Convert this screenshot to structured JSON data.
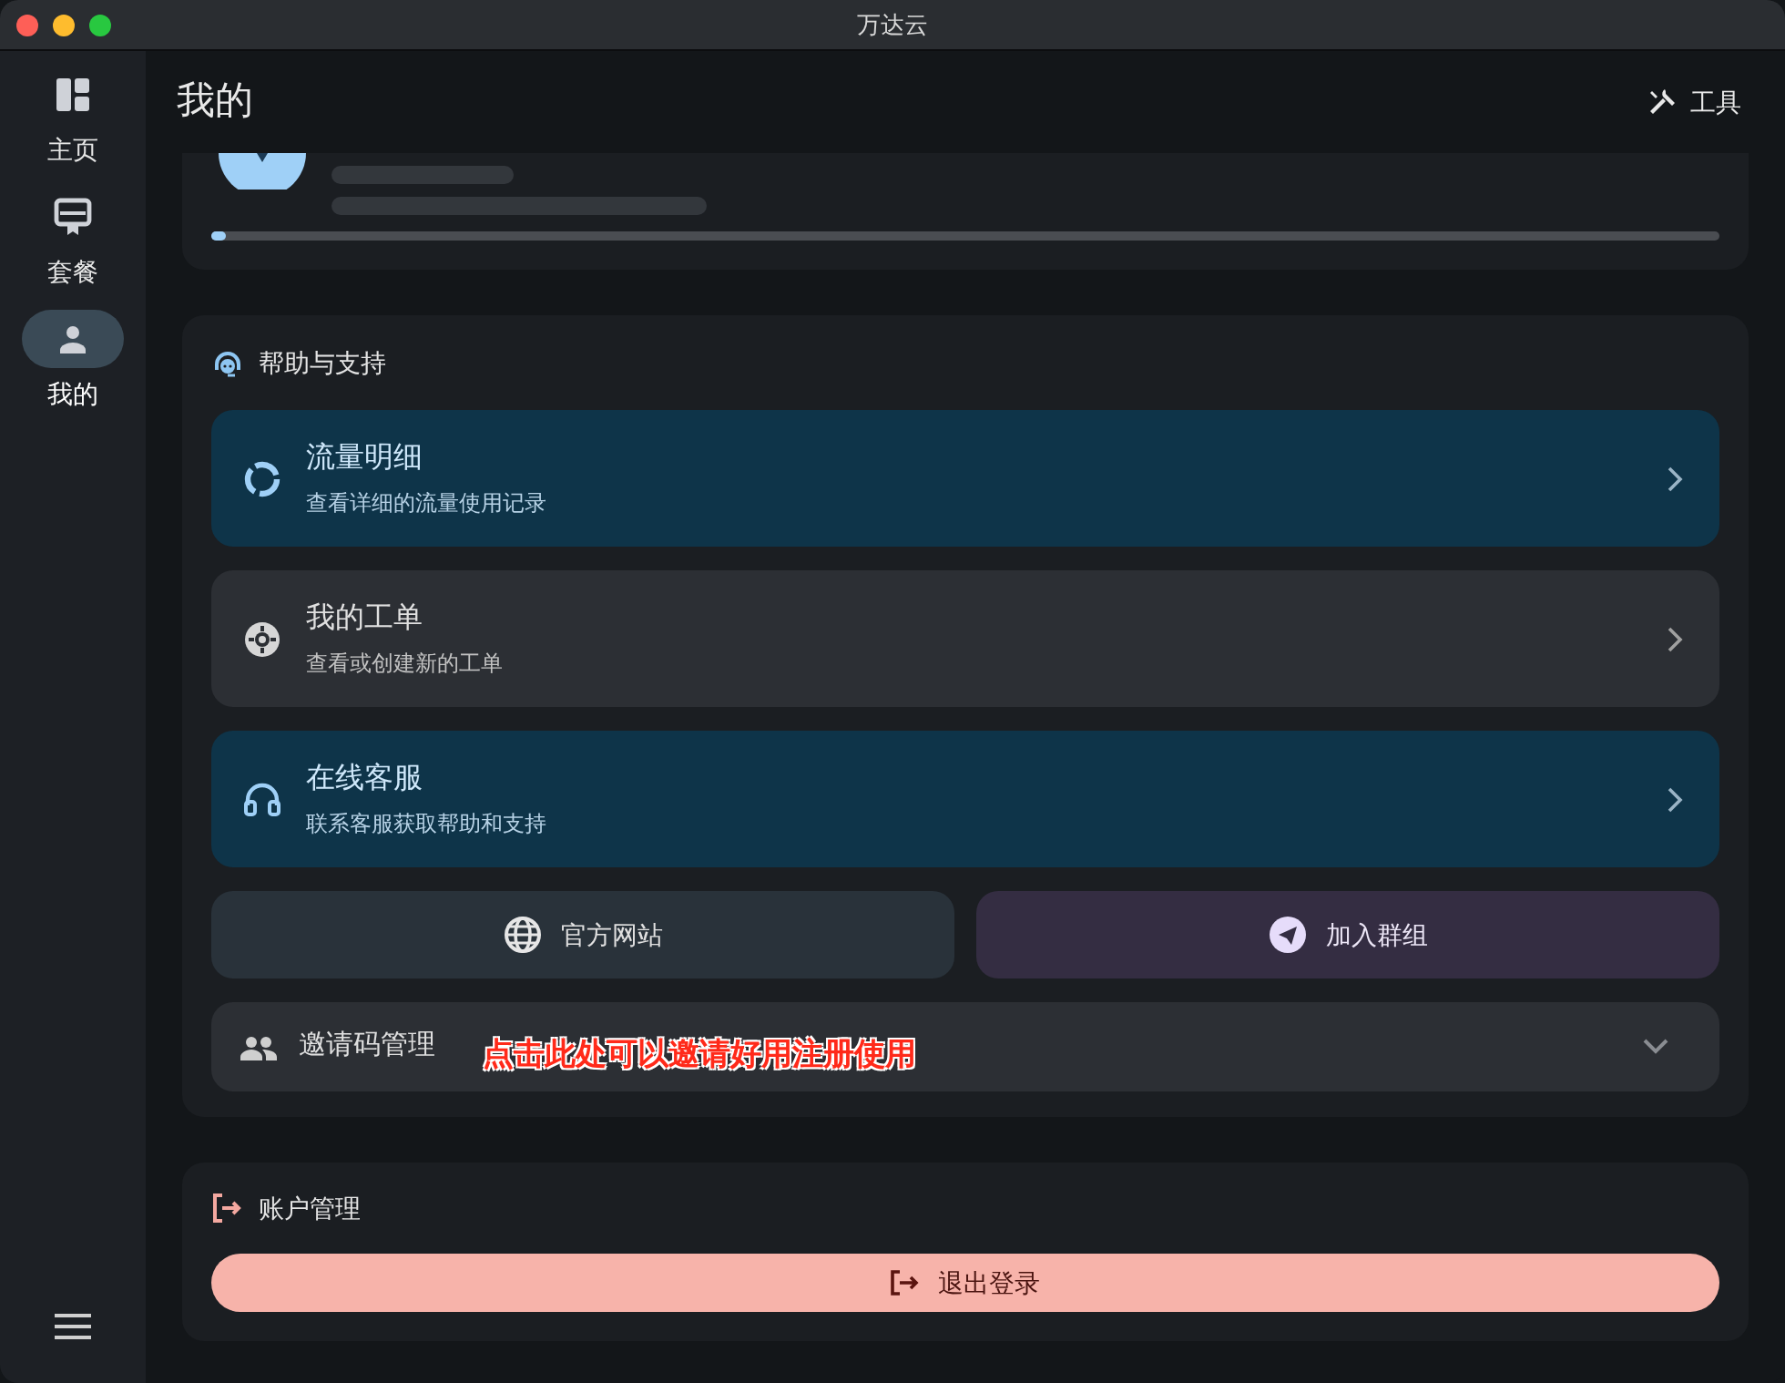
{
  "window": {
    "title": "万达云"
  },
  "sidebar": {
    "items": [
      {
        "label": "主页",
        "kind": "home",
        "selected": false
      },
      {
        "label": "套餐",
        "kind": "plan",
        "selected": false
      },
      {
        "label": "我的",
        "kind": "user",
        "selected": true
      }
    ]
  },
  "header": {
    "title": "我的",
    "tools": "工具"
  },
  "account_card": {
    "usage": {
      "level": 0.01
    }
  },
  "help": {
    "title": "帮助与支持",
    "items": [
      {
        "title": "流量明细",
        "subtitle": "查看详细的流量使用记录",
        "kind": "highlight"
      },
      {
        "title": "我的工单",
        "subtitle": "查看或创建新的工单",
        "kind": "plain"
      },
      {
        "title": "在线客服",
        "subtitle": "联系客服获取帮助和支持",
        "kind": "highlight"
      }
    ],
    "links": [
      {
        "label": "官方网站",
        "kind": "website"
      },
      {
        "label": "加入群组",
        "kind": "group"
      }
    ],
    "invite": {
      "label": "邀请码管理",
      "expanded": false,
      "annotation": "点击此处可以邀请好用注册使用"
    }
  },
  "account": {
    "title": "账户管理",
    "logout": "退出登录"
  }
}
